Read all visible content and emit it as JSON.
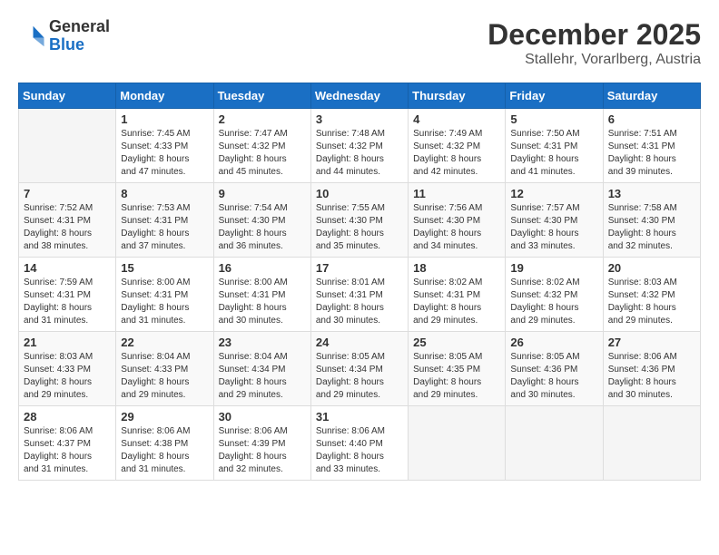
{
  "header": {
    "logo_general": "General",
    "logo_blue": "Blue",
    "month_year": "December 2025",
    "location": "Stallehr, Vorarlberg, Austria"
  },
  "days_of_week": [
    "Sunday",
    "Monday",
    "Tuesday",
    "Wednesday",
    "Thursday",
    "Friday",
    "Saturday"
  ],
  "weeks": [
    [
      {
        "day": "",
        "info": ""
      },
      {
        "day": "1",
        "info": "Sunrise: 7:45 AM\nSunset: 4:33 PM\nDaylight: 8 hours\nand 47 minutes."
      },
      {
        "day": "2",
        "info": "Sunrise: 7:47 AM\nSunset: 4:32 PM\nDaylight: 8 hours\nand 45 minutes."
      },
      {
        "day": "3",
        "info": "Sunrise: 7:48 AM\nSunset: 4:32 PM\nDaylight: 8 hours\nand 44 minutes."
      },
      {
        "day": "4",
        "info": "Sunrise: 7:49 AM\nSunset: 4:32 PM\nDaylight: 8 hours\nand 42 minutes."
      },
      {
        "day": "5",
        "info": "Sunrise: 7:50 AM\nSunset: 4:31 PM\nDaylight: 8 hours\nand 41 minutes."
      },
      {
        "day": "6",
        "info": "Sunrise: 7:51 AM\nSunset: 4:31 PM\nDaylight: 8 hours\nand 39 minutes."
      }
    ],
    [
      {
        "day": "7",
        "info": "Sunrise: 7:52 AM\nSunset: 4:31 PM\nDaylight: 8 hours\nand 38 minutes."
      },
      {
        "day": "8",
        "info": "Sunrise: 7:53 AM\nSunset: 4:31 PM\nDaylight: 8 hours\nand 37 minutes."
      },
      {
        "day": "9",
        "info": "Sunrise: 7:54 AM\nSunset: 4:30 PM\nDaylight: 8 hours\nand 36 minutes."
      },
      {
        "day": "10",
        "info": "Sunrise: 7:55 AM\nSunset: 4:30 PM\nDaylight: 8 hours\nand 35 minutes."
      },
      {
        "day": "11",
        "info": "Sunrise: 7:56 AM\nSunset: 4:30 PM\nDaylight: 8 hours\nand 34 minutes."
      },
      {
        "day": "12",
        "info": "Sunrise: 7:57 AM\nSunset: 4:30 PM\nDaylight: 8 hours\nand 33 minutes."
      },
      {
        "day": "13",
        "info": "Sunrise: 7:58 AM\nSunset: 4:30 PM\nDaylight: 8 hours\nand 32 minutes."
      }
    ],
    [
      {
        "day": "14",
        "info": "Sunrise: 7:59 AM\nSunset: 4:31 PM\nDaylight: 8 hours\nand 31 minutes."
      },
      {
        "day": "15",
        "info": "Sunrise: 8:00 AM\nSunset: 4:31 PM\nDaylight: 8 hours\nand 31 minutes."
      },
      {
        "day": "16",
        "info": "Sunrise: 8:00 AM\nSunset: 4:31 PM\nDaylight: 8 hours\nand 30 minutes."
      },
      {
        "day": "17",
        "info": "Sunrise: 8:01 AM\nSunset: 4:31 PM\nDaylight: 8 hours\nand 30 minutes."
      },
      {
        "day": "18",
        "info": "Sunrise: 8:02 AM\nSunset: 4:31 PM\nDaylight: 8 hours\nand 29 minutes."
      },
      {
        "day": "19",
        "info": "Sunrise: 8:02 AM\nSunset: 4:32 PM\nDaylight: 8 hours\nand 29 minutes."
      },
      {
        "day": "20",
        "info": "Sunrise: 8:03 AM\nSunset: 4:32 PM\nDaylight: 8 hours\nand 29 minutes."
      }
    ],
    [
      {
        "day": "21",
        "info": "Sunrise: 8:03 AM\nSunset: 4:33 PM\nDaylight: 8 hours\nand 29 minutes."
      },
      {
        "day": "22",
        "info": "Sunrise: 8:04 AM\nSunset: 4:33 PM\nDaylight: 8 hours\nand 29 minutes."
      },
      {
        "day": "23",
        "info": "Sunrise: 8:04 AM\nSunset: 4:34 PM\nDaylight: 8 hours\nand 29 minutes."
      },
      {
        "day": "24",
        "info": "Sunrise: 8:05 AM\nSunset: 4:34 PM\nDaylight: 8 hours\nand 29 minutes."
      },
      {
        "day": "25",
        "info": "Sunrise: 8:05 AM\nSunset: 4:35 PM\nDaylight: 8 hours\nand 29 minutes."
      },
      {
        "day": "26",
        "info": "Sunrise: 8:05 AM\nSunset: 4:36 PM\nDaylight: 8 hours\nand 30 minutes."
      },
      {
        "day": "27",
        "info": "Sunrise: 8:06 AM\nSunset: 4:36 PM\nDaylight: 8 hours\nand 30 minutes."
      }
    ],
    [
      {
        "day": "28",
        "info": "Sunrise: 8:06 AM\nSunset: 4:37 PM\nDaylight: 8 hours\nand 31 minutes."
      },
      {
        "day": "29",
        "info": "Sunrise: 8:06 AM\nSunset: 4:38 PM\nDaylight: 8 hours\nand 31 minutes."
      },
      {
        "day": "30",
        "info": "Sunrise: 8:06 AM\nSunset: 4:39 PM\nDaylight: 8 hours\nand 32 minutes."
      },
      {
        "day": "31",
        "info": "Sunrise: 8:06 AM\nSunset: 4:40 PM\nDaylight: 8 hours\nand 33 minutes."
      },
      {
        "day": "",
        "info": ""
      },
      {
        "day": "",
        "info": ""
      },
      {
        "day": "",
        "info": ""
      }
    ]
  ]
}
